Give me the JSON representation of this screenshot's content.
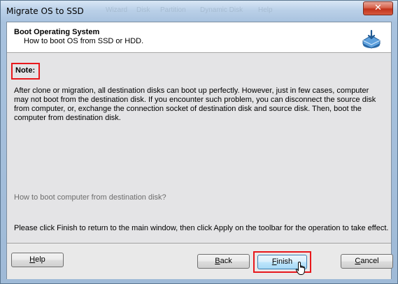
{
  "window": {
    "title": "Migrate OS to SSD",
    "background_menu_ghost": [
      "Wizard",
      "Disk",
      "Partition",
      "Dynamic Disk",
      "Help"
    ],
    "close_glyph": "✕"
  },
  "header": {
    "title": "Boot Operating System",
    "subtitle": "How to boot OS from SSD or HDD.",
    "icon": "disk-boot-icon"
  },
  "content": {
    "note_label": "Note:",
    "note_lines": [
      "After clone or migration, all destination disks can boot up perfectly. However, just in few cases, computer",
      "may not boot from the destination disk. If you encounter such problem, you can disconnect the source disk",
      "from computer, or, exchange the connection socket of destination disk and source disk. Then, boot the",
      "computer from destination disk."
    ],
    "howto_link": "How to boot computer from destination disk?",
    "instruction": "Please click Finish to return to the main window, then click Apply on the toolbar for the operation to take effect."
  },
  "footer": {
    "help": {
      "mnemonic": "H",
      "rest": "elp"
    },
    "back": {
      "mnemonic": "B",
      "rest": "ack"
    },
    "finish": {
      "mnemonic": "F",
      "rest": "inish"
    },
    "cancel": {
      "mnemonic": "C",
      "rest": "ancel"
    }
  },
  "colors": {
    "highlight_box": "#e8181c",
    "link_gray": "#6d6d6d"
  }
}
